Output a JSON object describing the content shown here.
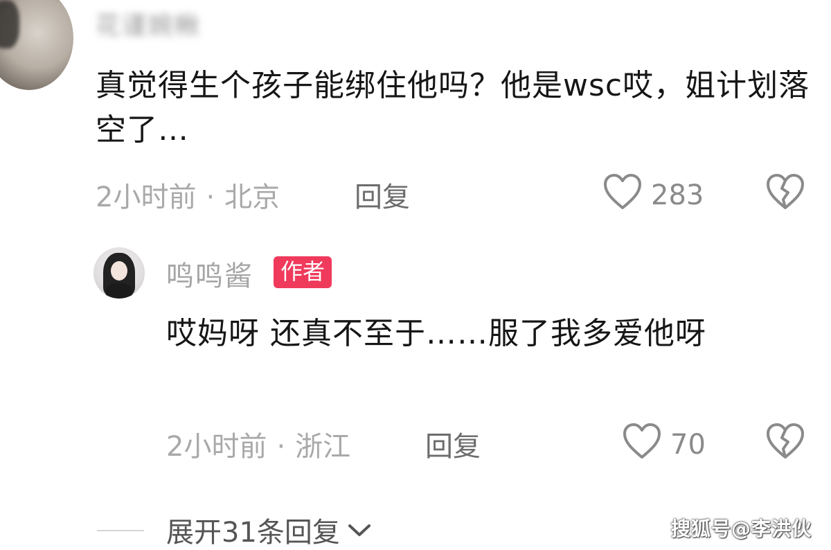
{
  "comment": {
    "username": "花谨婉楸",
    "text": "真觉得生个孩子能绑住他吗？他是wsc哎，姐计划落空了…",
    "time": "2小时前",
    "separator": "·",
    "location": "北京",
    "reply_label": "回复",
    "likes": "283",
    "icons": {
      "like": "heart-outline-icon",
      "dislike": "broken-heart-icon"
    }
  },
  "reply": {
    "username": "鸣鸣酱",
    "badge": "作者",
    "text": "哎妈呀 还真不至于……服了我多爱他呀",
    "time": "2小时前",
    "separator": "·",
    "location": "浙江",
    "reply_label": "回复",
    "likes": "70",
    "icons": {
      "like": "heart-outline-icon",
      "dislike": "broken-heart-icon"
    }
  },
  "expand": {
    "label": "展开31条回复",
    "icon": "chevron-down-icon"
  },
  "watermark": "搜狐号@李洪伙",
  "colors": {
    "badge": "#f03a5c",
    "meta_text": "#a9a9a9",
    "body_text": "#161616"
  }
}
